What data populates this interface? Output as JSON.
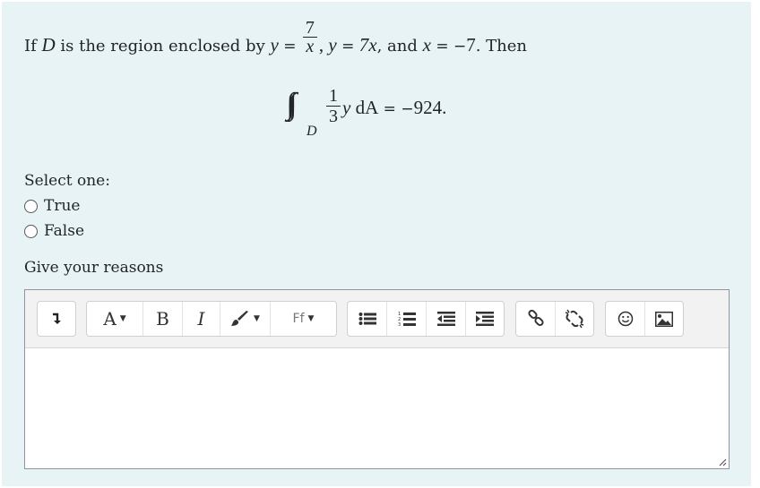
{
  "question": {
    "intro": "If ",
    "var_d": "D",
    "mid1": " is the region enclosed by ",
    "y1": "y",
    "eq1": " = ",
    "frac_num": "7",
    "frac_den": "x",
    "comma1": ", ",
    "y2": "y",
    "eq2": " = ",
    "rhs2": "7x",
    "and_text": ", and ",
    "x3": "x",
    "eq3": " = ",
    "minus3": "−",
    "rhs3": "7",
    "then_text": ". Then"
  },
  "equation": {
    "integral": "∫∫",
    "region": "D",
    "frac_num": "1",
    "frac_den": "3",
    "var_y": "y",
    "dA": " dA",
    "equals": " = ",
    "minus": "−",
    "value": "924."
  },
  "answer": {
    "prompt": "Select one:",
    "options": [
      {
        "label": "True",
        "selected": false
      },
      {
        "label": "False",
        "selected": false
      }
    ]
  },
  "reasons_label": "Give your reasons",
  "toolbar": {
    "font_a": "A",
    "bold": "B",
    "italic": "I",
    "font_family": "Ff"
  },
  "editor_content": ""
}
